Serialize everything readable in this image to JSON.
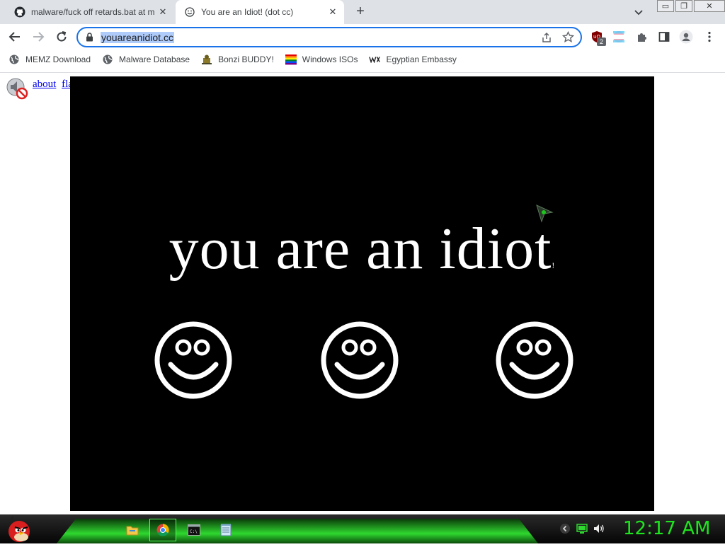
{
  "tabs": [
    {
      "title": "malware/fuck off retards.bat at m",
      "favicon": "github-icon",
      "active": false
    },
    {
      "title": "You are an Idiot! (dot cc)",
      "favicon": "smiley-icon",
      "active": true
    }
  ],
  "new_tab": "+",
  "window_buttons": {
    "minimize": "▭",
    "restore": "❐",
    "close": "✕"
  },
  "omnibox": {
    "url": "youareanidiot.cc"
  },
  "extensions": {
    "ublock_badge": "2"
  },
  "bookmarks": [
    {
      "label": "MEMZ Download",
      "icon": "globe-icon"
    },
    {
      "label": "Malware Database",
      "icon": "globe-icon"
    },
    {
      "label": "Bonzi BUDDY!",
      "icon": "bonzi-icon"
    },
    {
      "label": "Windows ISOs",
      "icon": "windows-flag-icon"
    },
    {
      "label": "Egyptian Embassy",
      "icon": "wix-icon"
    }
  ],
  "page": {
    "links": [
      {
        "label": "about"
      },
      {
        "label": "flash"
      }
    ],
    "headline": "you are an idiot",
    "headline_mark": "!",
    "smiley_count": 3
  },
  "taskbar": {
    "apps": [
      "file-explorer-icon",
      "chrome-icon",
      "cmd-icon",
      "notepad-icon"
    ],
    "clock": "12:17 AM"
  },
  "colors": {
    "accent": "#1a73e8",
    "stage": "#000000",
    "clock": "#1ee61e",
    "taskbar_glow": "#2fd82f"
  }
}
